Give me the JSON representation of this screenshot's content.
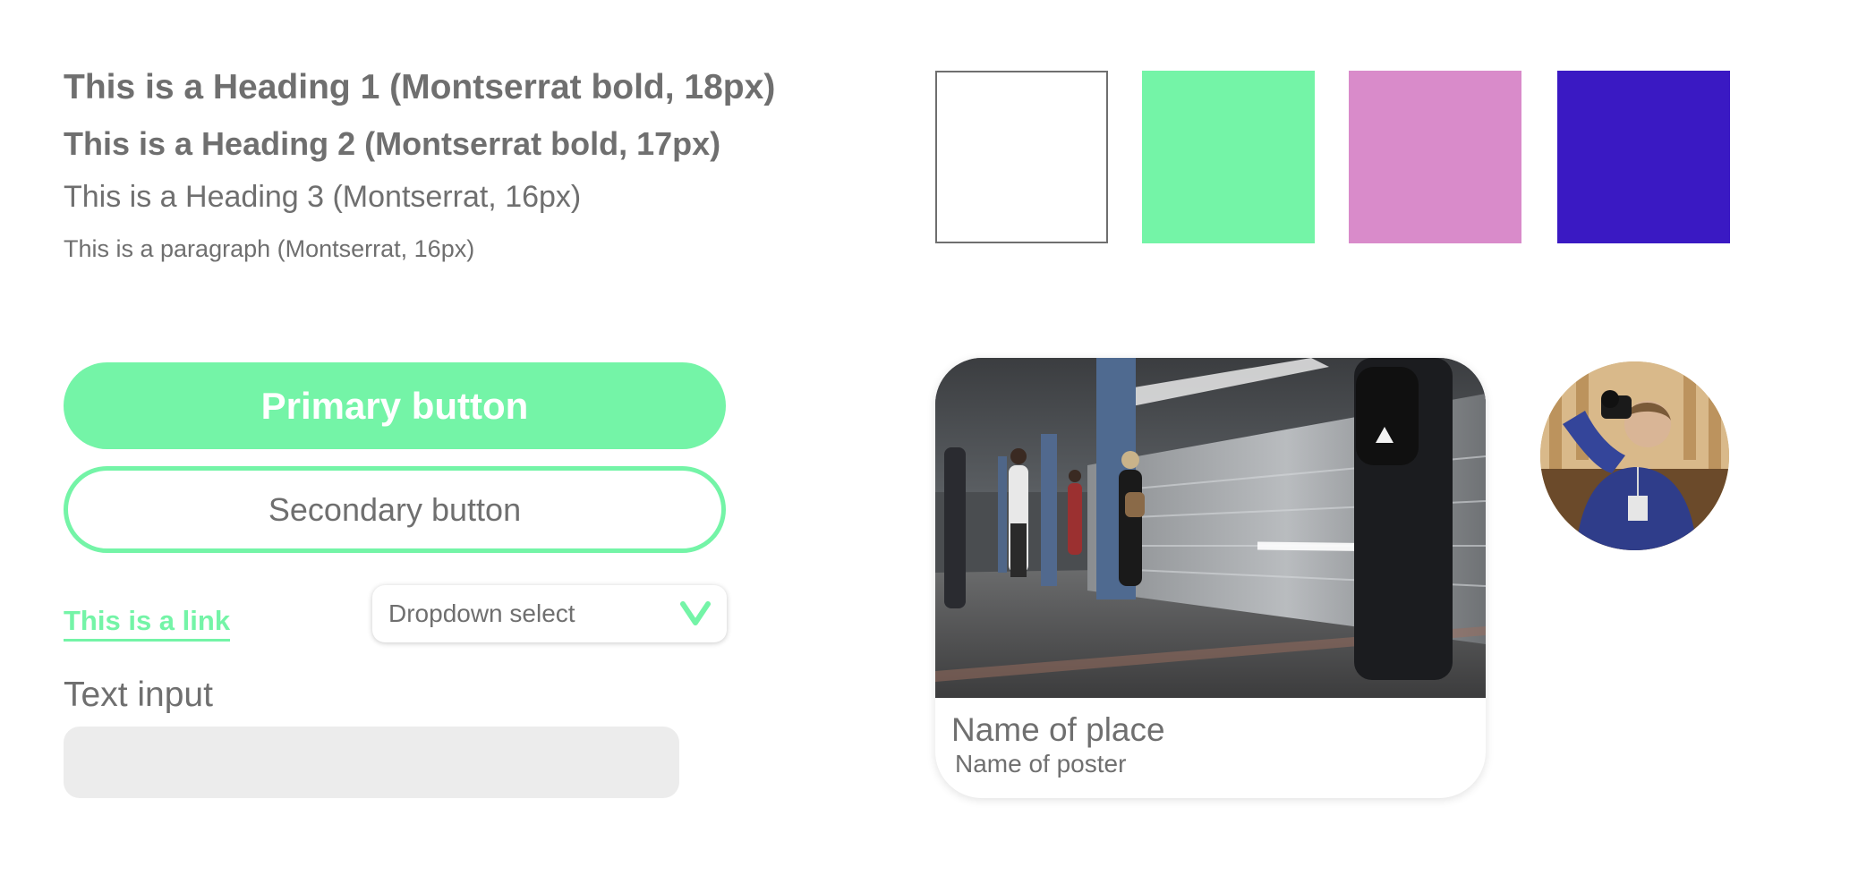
{
  "typography": {
    "heading1": "This is a Heading 1 (Montserrat bold, 18px)",
    "heading2": "This is a Heading 2 (Montserrat bold, 17px)",
    "heading3": "This is a Heading 3 (Montserrat, 16px)",
    "paragraph": "This is a paragraph (Montserrat, 16px)"
  },
  "palette": {
    "swatches": [
      "#ffffff",
      "#74f4a7",
      "#d98bca",
      "#3a19c3"
    ],
    "text_gray": "#6f6f6f",
    "accent": "#74f4a7"
  },
  "buttons": {
    "primary_label": "Primary button",
    "secondary_label": "Secondary button"
  },
  "link": {
    "label": "This is a link"
  },
  "dropdown": {
    "value": "Dropdown select",
    "icon": "chevron-down-icon"
  },
  "text_input": {
    "label": "Text input",
    "value": "",
    "placeholder": ""
  },
  "place_card": {
    "place_name": "Name of place",
    "poster_name": "Name of poster"
  },
  "avatar": {
    "icon": "user-avatar"
  }
}
